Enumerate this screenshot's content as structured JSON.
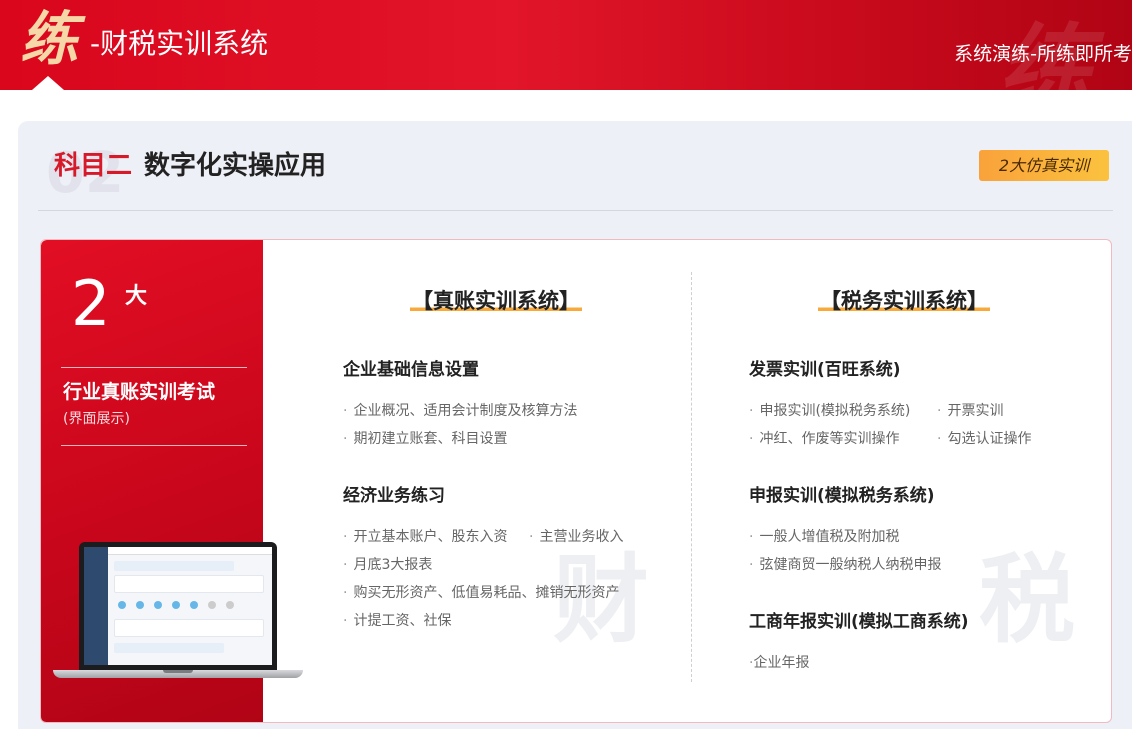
{
  "header": {
    "logo_char": "练",
    "title": "-财税实训系统",
    "slogan": "系统演练-所练即所考"
  },
  "section": {
    "subject": "科目二",
    "subject_title": "数字化实操应用",
    "tag": "2大仿真实训"
  },
  "left_panel": {
    "number": "2",
    "number_suffix": "大",
    "caption": "行业真账实训考试",
    "sub_caption": "(界面展示)"
  },
  "systems": [
    {
      "title": "【真账实训系统】",
      "watermark": "财",
      "groups": [
        {
          "heading": "企业基础信息设置",
          "items": [
            "企业概况、适用会计制度及核算方法",
            "期初建立账套、科目设置"
          ]
        },
        {
          "heading": "经济业务练习",
          "items": [
            "开立基本账户、股东入资",
            "主营业务收入",
            "月底3大报表",
            "购买无形资产、低值易耗品、摊销无形资产",
            "计提工资、社保"
          ]
        }
      ]
    },
    {
      "title": "【税务实训系统】",
      "watermark": "税",
      "groups": [
        {
          "heading": "发票实训(百旺系统)",
          "items": [
            "申报实训(模拟税务系统)",
            "开票实训",
            "冲红、作废等实训操作",
            "勾选认证操作"
          ]
        },
        {
          "heading": "申报实训(模拟税务系统)",
          "items": [
            "一般人增值税及附加税",
            "弦健商贸一般纳税人纳税申报"
          ]
        },
        {
          "heading": "工商年报实训(模拟工商系统)",
          "items": [
            "企业年报"
          ]
        }
      ]
    }
  ],
  "colors": {
    "brand_red": "#d9061c",
    "tag_orange": "#f9a23b",
    "underline": "#f8a93a"
  }
}
